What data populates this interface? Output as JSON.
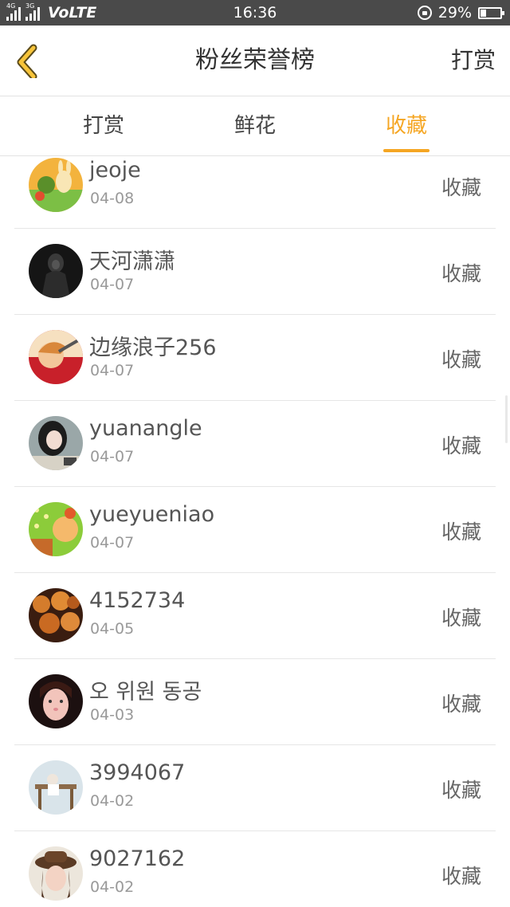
{
  "status_bar": {
    "net1": "4G",
    "net2": "3G",
    "volte": "VoLTE",
    "time": "16:36",
    "battery": "29%",
    "battery_level": 0.29
  },
  "header": {
    "title": "粉丝荣誉榜",
    "action": "打赏"
  },
  "tabs": [
    {
      "label": "打赏",
      "active": false
    },
    {
      "label": "鲜花",
      "active": false
    },
    {
      "label": "收藏",
      "active": true
    }
  ],
  "rows": [
    {
      "name": "jeoje",
      "date": "04-08",
      "action": "收藏"
    },
    {
      "name": "天河潇潇",
      "date": "04-07",
      "action": "收藏"
    },
    {
      "name": "边缘浪子256",
      "date": "04-07",
      "action": "收藏"
    },
    {
      "name": "yuanangle",
      "date": "04-07",
      "action": "收藏"
    },
    {
      "name": "yueyueniao",
      "date": "04-07",
      "action": "收藏"
    },
    {
      "name": "4152734",
      "date": "04-05",
      "action": "收藏"
    },
    {
      "name": "오 위원 동공",
      "date": "04-03",
      "action": "收藏"
    },
    {
      "name": "3994067",
      "date": "04-02",
      "action": "收藏"
    },
    {
      "name": "9027162",
      "date": "04-02",
      "action": "收藏"
    }
  ],
  "colors": {
    "accent": "#f5a623",
    "status_bar": "#4a4a4a"
  }
}
